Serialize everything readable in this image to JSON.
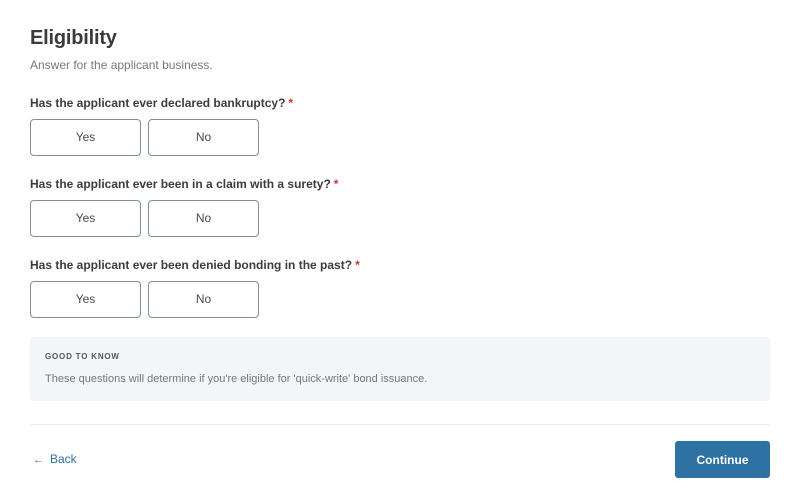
{
  "header": {
    "title": "Eligibility",
    "subtitle": "Answer for the applicant business."
  },
  "questions": [
    {
      "label": "Has the applicant ever declared bankruptcy?",
      "required_mark": "*",
      "yes_label": "Yes",
      "no_label": "No"
    },
    {
      "label": "Has the applicant ever been in a claim with a surety?",
      "required_mark": "*",
      "yes_label": "Yes",
      "no_label": "No"
    },
    {
      "label": "Has the applicant ever been denied bonding in the past?",
      "required_mark": "*",
      "yes_label": "Yes",
      "no_label": "No"
    }
  ],
  "info": {
    "heading": "GOOD TO KNOW",
    "text": "These questions will determine if you're eligible for 'quick-write' bond issuance."
  },
  "footer": {
    "back_arrow": "←",
    "back_label": "Back",
    "continue_label": "Continue"
  },
  "colors": {
    "primary": "#2e71a3",
    "required": "#d0342c",
    "info_bg": "#f4f5f7"
  }
}
